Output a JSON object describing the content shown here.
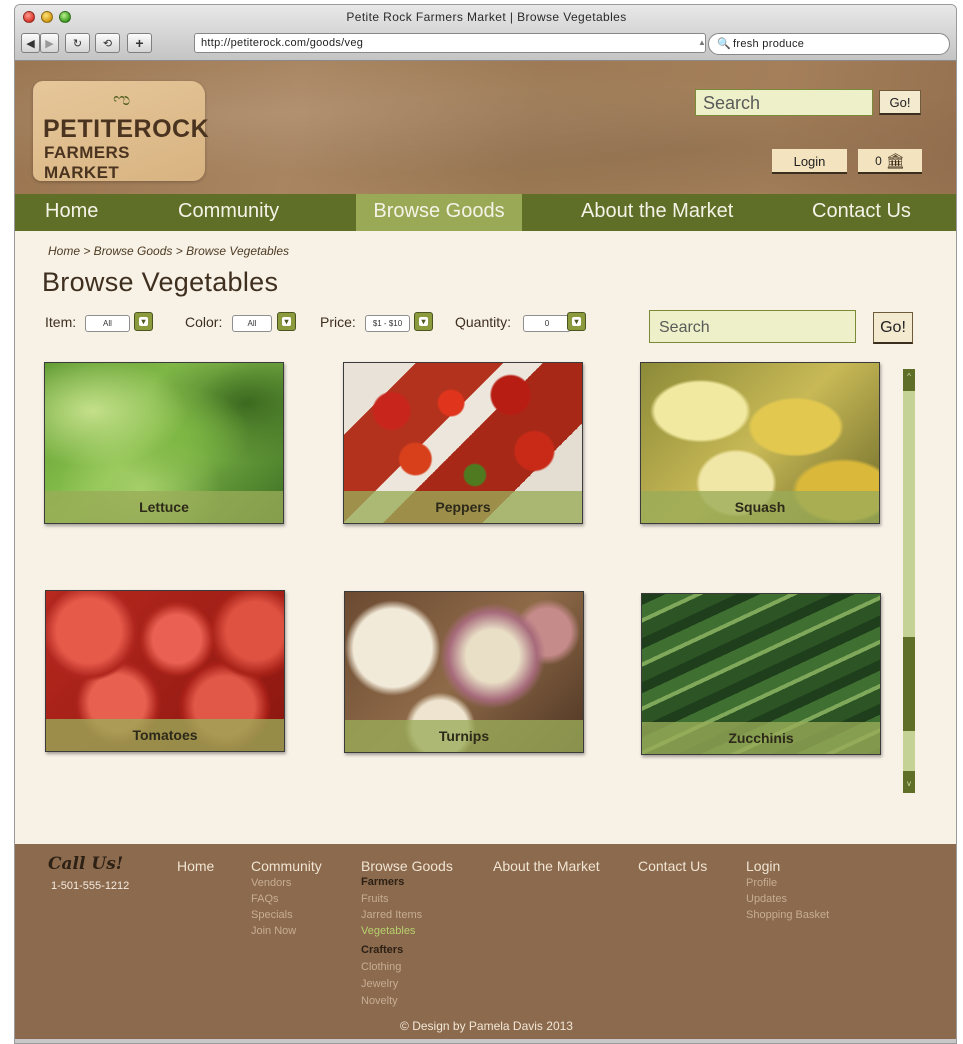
{
  "browser": {
    "window_title": "Petite Rock Farmers Market | Browse Vegetables",
    "url": "http://petiterock.com/goods/veg",
    "search_value": "fresh produce"
  },
  "header": {
    "logo_line1": "PETITEROCK",
    "logo_line2": "FARMERS MARKET",
    "search_placeholder": "Search",
    "go_label": "Go!",
    "login_label": "Login",
    "cart_count": "0",
    "cart_icon": "basket-icon"
  },
  "nav": {
    "items": [
      {
        "label": "Home"
      },
      {
        "label": "Community"
      },
      {
        "label": "Browse Goods",
        "active": true
      },
      {
        "label": "About the Market"
      },
      {
        "label": "Contact Us"
      }
    ]
  },
  "breadcrumb": "Home > Browse Goods > Browse Vegetables",
  "page_title": "Browse Vegetables",
  "filters": {
    "item": {
      "label": "Item:",
      "value": "All"
    },
    "color": {
      "label": "Color:",
      "value": "All"
    },
    "price": {
      "label": "Price:",
      "value": "$1 - $10"
    },
    "quantity": {
      "label": "Quantity:",
      "value": "0"
    }
  },
  "main_search": {
    "placeholder": "Search",
    "go_label": "Go!"
  },
  "products": [
    {
      "name": "Lettuce"
    },
    {
      "name": "Peppers"
    },
    {
      "name": "Squash"
    },
    {
      "name": "Tomatoes"
    },
    {
      "name": "Turnips"
    },
    {
      "name": "Zucchinis"
    }
  ],
  "scrollbar": {
    "up": "^",
    "down": "v"
  },
  "footer": {
    "call_us": "Call Us!",
    "phone": "1-501-555-1212",
    "home": "Home",
    "community": {
      "title": "Community",
      "links": [
        "Vendors",
        "FAQs",
        "Specials",
        "Join Now"
      ]
    },
    "browse": {
      "title": "Browse Goods",
      "farmers_heading": "Farmers",
      "farmers_links": [
        "Fruits",
        "Jarred Items",
        "Vegetables"
      ],
      "crafters_heading": "Crafters",
      "crafters_links": [
        "Clothing",
        "Jewelry",
        "Novelty"
      ]
    },
    "about": "About the Market",
    "contact": "Contact Us",
    "login": {
      "title": "Login",
      "links": [
        "Profile",
        "Updates",
        "Shopping Basket"
      ]
    },
    "copyright": "© Design by Pamela Davis 2013"
  },
  "colors": {
    "nav_bg": "#5f6f27",
    "nav_active": "#9aa956",
    "footer_bg": "#8b6a4e",
    "page_bg": "#f7f1e6",
    "current_link": "#b8d06e"
  }
}
